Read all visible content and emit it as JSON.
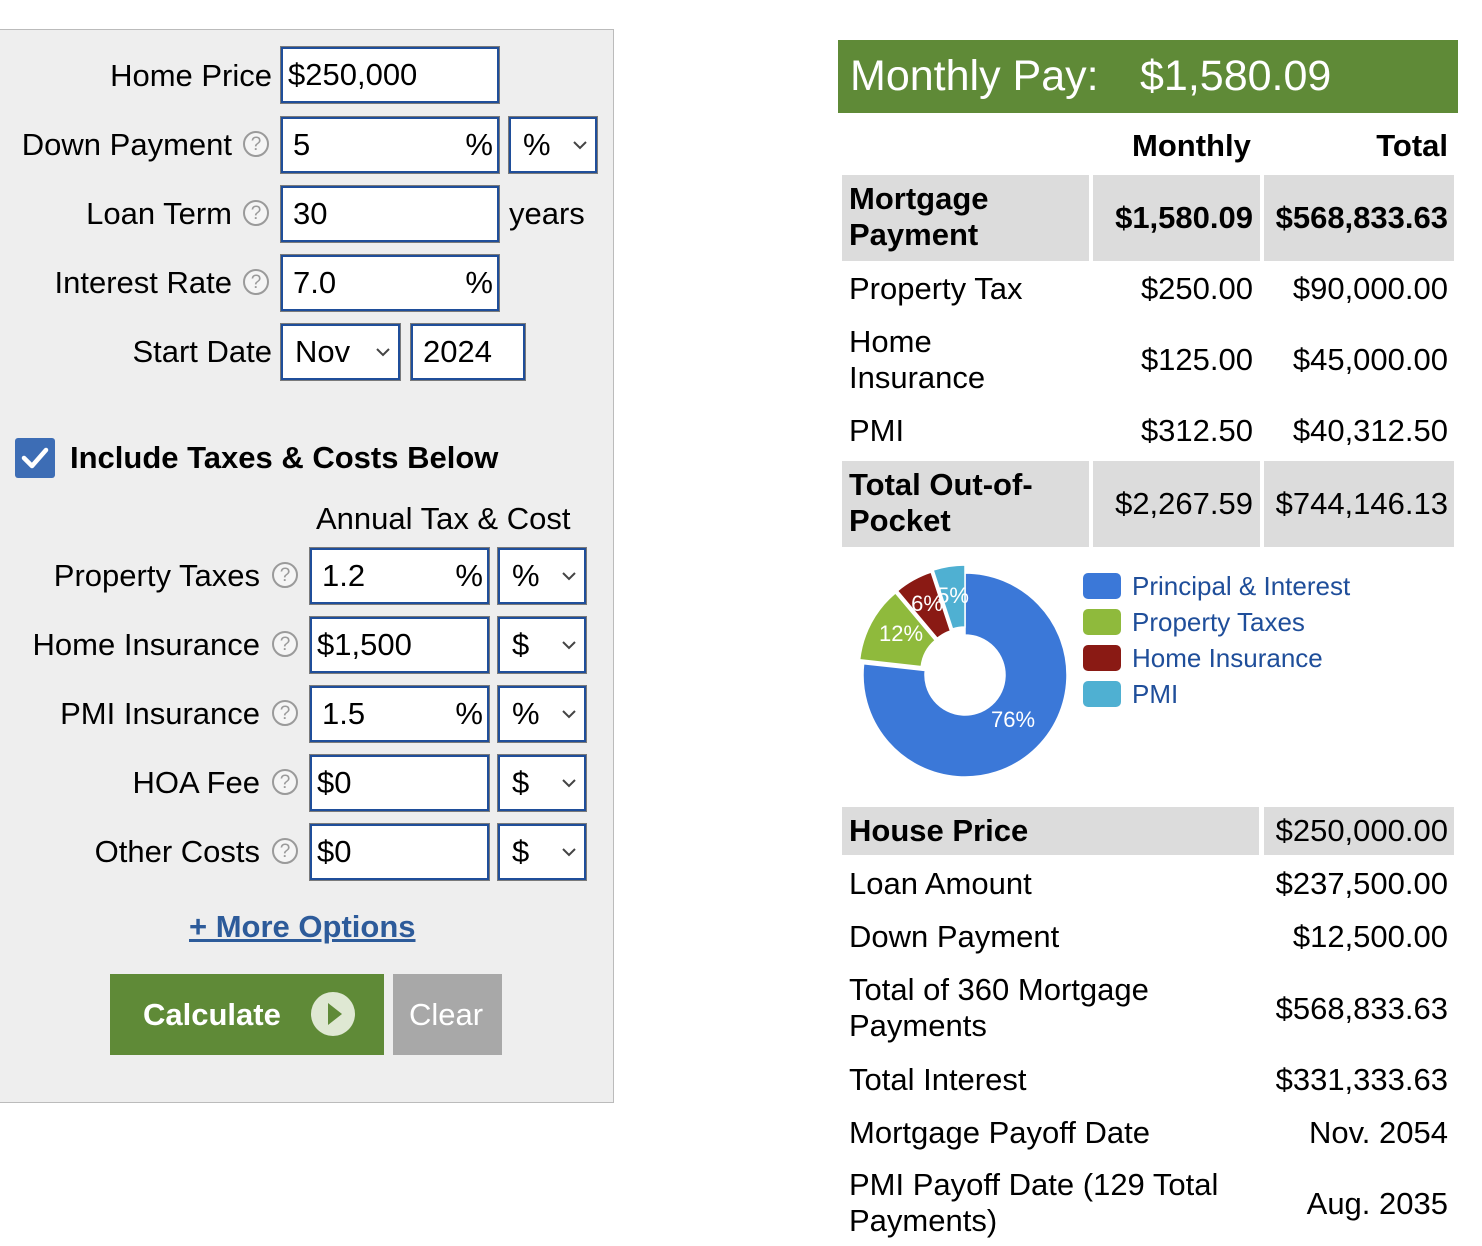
{
  "form": {
    "home_price": {
      "label": "Home Price",
      "value": "$250,000"
    },
    "down_payment": {
      "label": "Down Payment",
      "value": "5",
      "unit": "%",
      "unit_select": "%"
    },
    "loan_term": {
      "label": "Loan Term",
      "value": "30",
      "suffix": "years"
    },
    "interest_rate": {
      "label": "Interest Rate",
      "value": "7.0",
      "unit": "%"
    },
    "start_date": {
      "label": "Start Date",
      "month": "Nov",
      "year": "2024"
    },
    "include_taxes": {
      "label": "Include Taxes & Costs Below",
      "checked": true
    },
    "annual_header": "Annual Tax & Cost",
    "property_taxes": {
      "label": "Property Taxes",
      "value": "1.2",
      "unit": "%",
      "unit_select": "%"
    },
    "home_insurance": {
      "label": "Home Insurance",
      "value": "$1,500",
      "unit_select": "$"
    },
    "pmi_insurance": {
      "label": "PMI Insurance",
      "value": "1.5",
      "unit": "%",
      "unit_select": "%"
    },
    "hoa_fee": {
      "label": "HOA Fee",
      "value": "$0",
      "unit_select": "$"
    },
    "other_costs": {
      "label": "Other Costs",
      "value": "$0",
      "unit_select": "$"
    },
    "more_options": "+ More Options",
    "calculate": "Calculate",
    "clear": "Clear",
    "help_glyph": "?"
  },
  "result": {
    "monthly_pay_label": "Monthly Pay:",
    "monthly_pay_value": "$1,580.09",
    "col_monthly": "Monthly",
    "col_total": "Total",
    "rows": [
      {
        "label": "Mortgage Payment",
        "monthly": "$1,580.09",
        "total": "$568,833.63"
      },
      {
        "label": "Property Tax",
        "monthly": "$250.00",
        "total": "$90,000.00"
      },
      {
        "label": "Home Insurance",
        "monthly": "$125.00",
        "total": "$45,000.00"
      },
      {
        "label": "PMI",
        "monthly": "$312.50",
        "total": "$40,312.50"
      },
      {
        "label": "Total Out-of-Pocket",
        "monthly": "$2,267.59",
        "total": "$744,146.13"
      }
    ]
  },
  "chart_data": {
    "type": "pie",
    "categories": [
      "Principal & Interest",
      "Property Taxes",
      "Home Insurance",
      "PMI"
    ],
    "values": [
      76,
      12,
      6,
      5
    ],
    "labels": [
      "76%",
      "12%",
      "6%",
      "5%"
    ],
    "colors": [
      "#3b78d8",
      "#8fba3c",
      "#8a1a14",
      "#4fb0d2"
    ],
    "legend": "right"
  },
  "summary": [
    {
      "label": "House Price",
      "value": "$250,000.00"
    },
    {
      "label": "Loan Amount",
      "value": "$237,500.00"
    },
    {
      "label": "Down Payment",
      "value": "$12,500.00"
    },
    {
      "label": "Total of 360 Mortgage Payments",
      "value": "$568,833.63"
    },
    {
      "label": "Total Interest",
      "value": "$331,333.63"
    },
    {
      "label": "Mortgage Payoff Date",
      "value": "Nov. 2054"
    },
    {
      "label": "PMI Payoff Date (129 Total Payments)",
      "value": "Aug. 2035"
    }
  ]
}
